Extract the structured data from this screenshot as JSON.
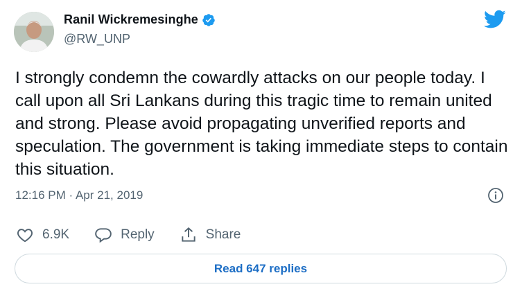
{
  "user": {
    "name": "Ranil Wickremesinghe",
    "handle": "@RW_UNP",
    "verified_icon": "verified-badge-icon"
  },
  "tweet": {
    "text": "I strongly condemn the cowardly attacks on our people today. I call upon all Sri Lankans during this tragic time to remain united and strong. Please avoid propagating unverified reports and speculation. The government is taking immediate steps to contain this situation.",
    "time": "12:16 PM",
    "separator": "·",
    "date": "Apr 21, 2019"
  },
  "actions": {
    "like_count": "6.9K",
    "reply_label": "Reply",
    "share_label": "Share"
  },
  "replies_button": "Read 647 replies",
  "colors": {
    "twitter_blue": "#1d9bf0",
    "link_blue": "#1d6ec5",
    "muted": "#536471",
    "border": "#cfd9de"
  }
}
